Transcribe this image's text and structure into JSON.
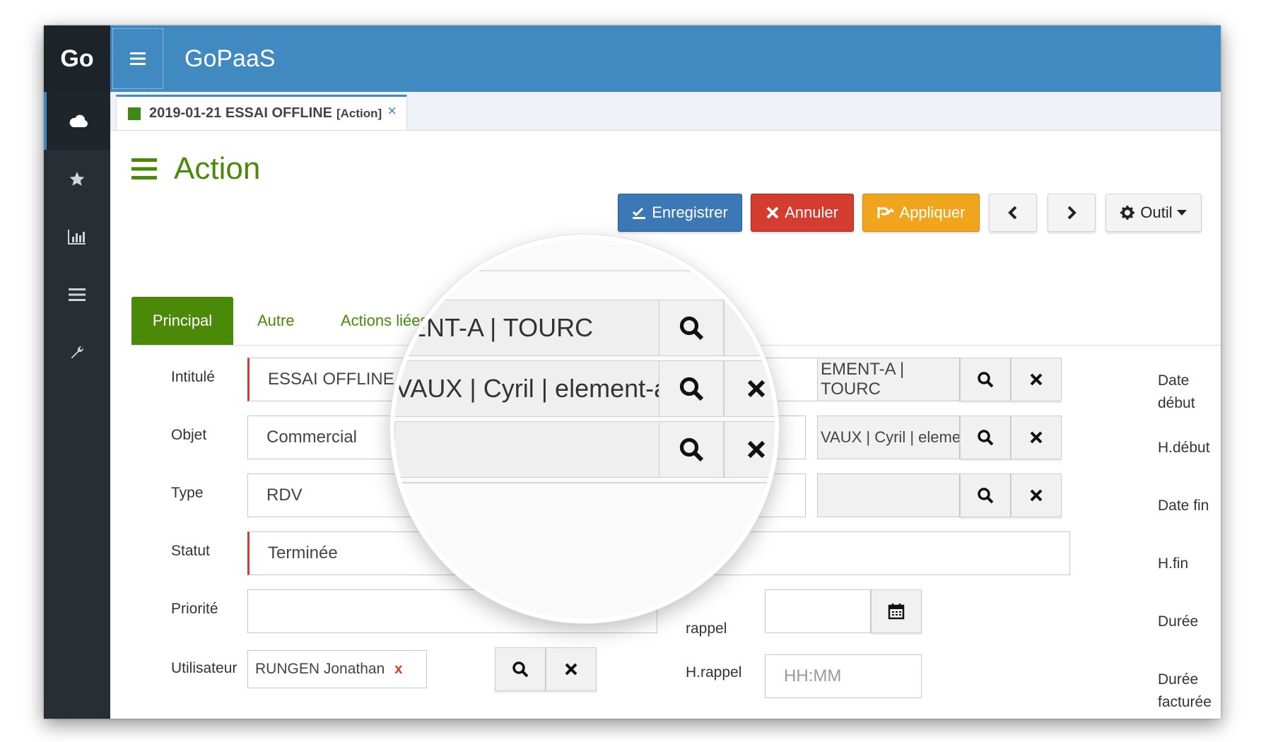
{
  "sidebar": {
    "logo": "Go",
    "items": [
      {
        "icon": "cloud-icon"
      },
      {
        "icon": "star-icon"
      },
      {
        "icon": "bar-chart-icon"
      },
      {
        "icon": "list-icon"
      },
      {
        "icon": "wrench-icon"
      }
    ]
  },
  "header": {
    "app_title": "GoPaaS"
  },
  "doc_tab": {
    "title": "2019-01-21 ESSAI OFFLINE",
    "tag": "[Action]",
    "close": "×"
  },
  "page": {
    "title": "Action"
  },
  "toolbar": {
    "save_label": "Enregistrer",
    "cancel_label": "Annuler",
    "apply_label": "Appliquer",
    "tool_label": "Outil"
  },
  "form_tabs": [
    "Principal",
    "Autre",
    "Actions liées"
  ],
  "fields": {
    "intitule": {
      "label": "Intitulé",
      "value": "ESSAI OFFLINE"
    },
    "objet": {
      "label": "Objet",
      "value": "Commercial"
    },
    "type": {
      "label": "Type",
      "value": "RDV"
    },
    "statut": {
      "label": "Statut",
      "value": "Terminée"
    },
    "priorite": {
      "label": "Priorité",
      "value": ""
    },
    "utilisateur": {
      "label": "Utilisateur",
      "value": "RUNGEN Jonathan",
      "remove": "x"
    },
    "societe_value": "EMENT-A | TOURC",
    "contact_value": "VAUX | Cyril | element-a",
    "rappel_label_partial": "rappel",
    "hrappel": {
      "label": "H.rappel",
      "placeholder": "HH:MM"
    }
  },
  "right_labels": {
    "date_debut_1": "Date",
    "date_debut_2": "début",
    "h_debut": "H.début",
    "date_fin": "Date fin",
    "h_fin": "H.fin",
    "duree": "Durée",
    "duree_facturee_1": "Durée",
    "duree_facturee_2": "facturée"
  },
  "lens": {
    "row1_value": "IENT-A | TOURC",
    "row2_value": "VAUX | Cyril | element-a"
  }
}
